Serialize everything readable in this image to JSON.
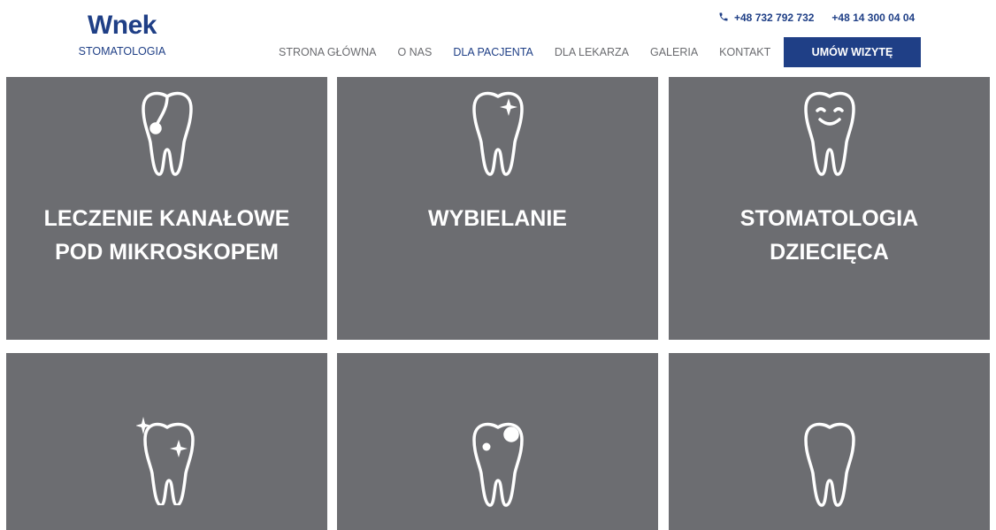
{
  "brand": {
    "name": "Wnek",
    "sub": "STOMATOLOGIA",
    "color": "#1f3f86"
  },
  "contact": {
    "phones": [
      "+48 732 792 732",
      "+48 14 300 04 04"
    ],
    "phone_icon": "phone-icon"
  },
  "nav": {
    "items": [
      {
        "label": "STRONA GŁÓWNA",
        "active": false
      },
      {
        "label": "O NAS",
        "active": false
      },
      {
        "label": "DLA PACJENTA",
        "active": true
      },
      {
        "label": "DLA LEKARZA",
        "active": false
      },
      {
        "label": "GALERIA",
        "active": false
      },
      {
        "label": "KONTAKT",
        "active": false
      }
    ],
    "cta": "UMÓW WIZYTĘ"
  },
  "tiles": [
    {
      "title_line1": "LECZENIE KANAŁOWE",
      "title_line2": "POD MIKROSKOPEM",
      "icon": "tooth-root-canal-icon"
    },
    {
      "title_line1": "WYBIELANIE",
      "title_line2": "",
      "icon": "tooth-sparkle-icon"
    },
    {
      "title_line1": "STOMATOLOGIA",
      "title_line2": "DZIECIĘCA",
      "icon": "tooth-smile-icon"
    },
    {
      "title_line1": "",
      "title_line2": "",
      "icon": "tooth-stars-icon"
    },
    {
      "title_line1": "",
      "title_line2": "",
      "icon": "tooth-decay-icon"
    },
    {
      "title_line1": "",
      "title_line2": "",
      "icon": "tooth-plain-icon"
    }
  ],
  "colors": {
    "tile_bg": "#6c6d71",
    "nav_text": "#6b6c70",
    "accent": "#1f3f86"
  }
}
